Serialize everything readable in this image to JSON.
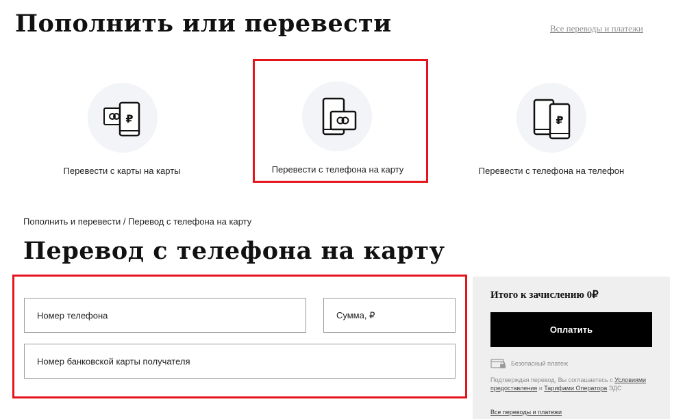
{
  "header": {
    "title": "Пополнить или перевести",
    "all_link": "Все переводы и платежи"
  },
  "options": [
    {
      "label": "Перевести с карты на карты",
      "icon": "card-to-phone-icon"
    },
    {
      "label": "Перевести с телефона на карту",
      "icon": "phone-to-card-icon"
    },
    {
      "label": "Перевести с телефона на телефон",
      "icon": "phone-to-phone-icon"
    }
  ],
  "breadcrumb": "Пополнить и перевести / Перевод с телефона на карту",
  "form": {
    "title": "Перевод с телефона на карту",
    "phone_placeholder": "Номер телефона",
    "amount_placeholder": "Сумма, ₽",
    "card_placeholder": "Номер банковской карты получателя"
  },
  "sidebar": {
    "total_label": "Итого к зачислению 0₽",
    "pay_button": "Оплатить",
    "secure": "Безопасный платеж",
    "terms_prefix": "Подтверждая перевод, Вы соглашаетесь с",
    "terms_link1": "Условиями предоставления",
    "terms_and": " и ",
    "terms_link2": "Тарифами Оператора",
    "terms_suffix": "ЭДС",
    "bottom_link": "Все переводы и платежи"
  },
  "colors": {
    "highlight": "#e3141b",
    "circle_bg": "#f3f4f7",
    "panel_bg": "#efefef",
    "pay_bg": "#000000"
  }
}
